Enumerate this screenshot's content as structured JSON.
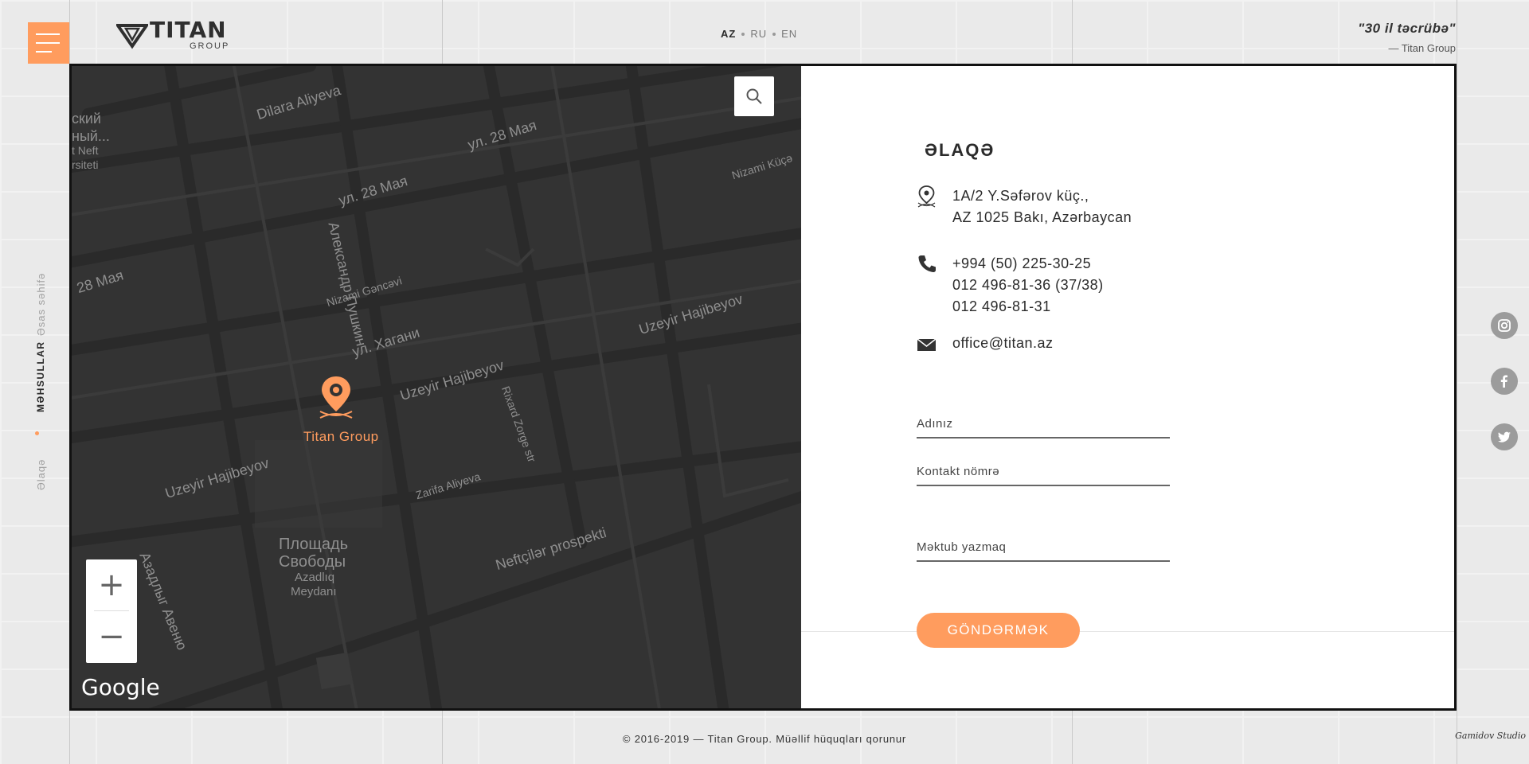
{
  "header": {
    "logo_title": "TITAN",
    "logo_sub": "GROUP",
    "languages": [
      {
        "code": "AZ",
        "active": true
      },
      {
        "code": "RU",
        "active": false
      },
      {
        "code": "EN",
        "active": false
      }
    ],
    "quote_text": "\"30 il təcrübə\"",
    "quote_author": "— Titan Group"
  },
  "side_nav": [
    {
      "label": "Əsas səhifə"
    },
    {
      "label": "MƏHSULLAR",
      "active": true
    },
    {
      "label": "Əlaqə"
    }
  ],
  "map": {
    "marker_label": "Titan Group",
    "zoom_in": "+",
    "zoom_out": "−",
    "attribution": "Google",
    "streets": [
      "Dilara Aliyeva",
      "ул. 28 Мая",
      "ул. 28 Мая",
      "28 Мая",
      "Nizami Küçə",
      "Александр Пушкин",
      "Nizami Gəncəvi",
      "ул. Хагани",
      "Uzeyir Hajibeyov",
      "Uzeyir Hajibeyov",
      "Uzeyir Hajibeyov",
      "Rixard Zorge str",
      "Zarifa Aliyeva",
      "Neftçilər prospekti",
      "Азадлыг Авеню",
      "Площадь",
      "Свободы",
      "Azadlıq",
      "Meydanı",
      "ский",
      "ный...",
      "t Neft",
      "rsiteti"
    ]
  },
  "contact": {
    "title": "ƏLAQƏ",
    "address": [
      "1A/2 Y.Səfərov küç.,",
      "AZ 1025 Bakı, Azərbaycan"
    ],
    "phones": [
      "+994 (50) 225-30-25",
      "012 496-81-36 (37/38)",
      "012 496-81-31"
    ],
    "email": "office@titan.az"
  },
  "form": {
    "name_placeholder": "Adınız",
    "phone_placeholder": "Kontakt nömrə",
    "message_placeholder": "Məktub yazmaq",
    "submit_label": "GÖNDƏRMƏK"
  },
  "footer": {
    "copyright": "© 2016-2019 — Titan Group. Müəllif hüquqları qorunur",
    "studio": "Gamidov Studio"
  },
  "colors": {
    "accent": "#ff9c5e",
    "map_bg": "#333333",
    "frame": "#111111"
  }
}
